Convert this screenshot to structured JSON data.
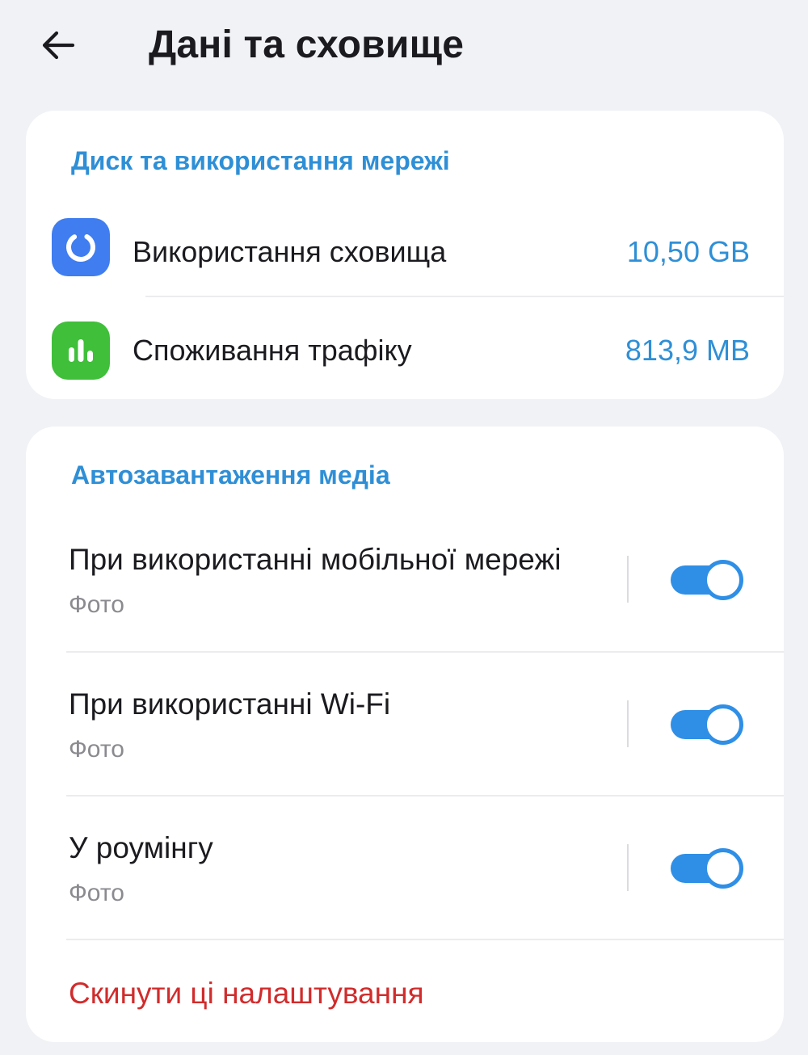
{
  "header": {
    "back_icon": "arrow-back-icon",
    "title": "Дані та сховище"
  },
  "storage_section": {
    "title": "Диск та використання мережі",
    "items": [
      {
        "label": "Використання сховища",
        "value": "10,50 GB",
        "icon": "storage-pie-icon",
        "icon_color": "#3f7df0"
      },
      {
        "label": "Споживання трафіку",
        "value": "813,9 MB",
        "icon": "bar-chart-icon",
        "icon_color": "#3fbf3a"
      }
    ]
  },
  "media_section": {
    "title": "Автозавантаження медіа",
    "items": [
      {
        "title": "При використанні мобільної мережі",
        "subtitle": "Фото",
        "enabled": true
      },
      {
        "title": "При використанні Wi-Fi",
        "subtitle": "Фото",
        "enabled": true
      },
      {
        "title": "У роумінгу",
        "subtitle": "Фото",
        "enabled": true
      }
    ],
    "reset_label": "Скинути ці налаштування"
  },
  "colors": {
    "accent": "#2f8fd6",
    "switch_on": "#2f8fe6",
    "danger": "#d12c2c",
    "background": "#f1f2f6"
  }
}
